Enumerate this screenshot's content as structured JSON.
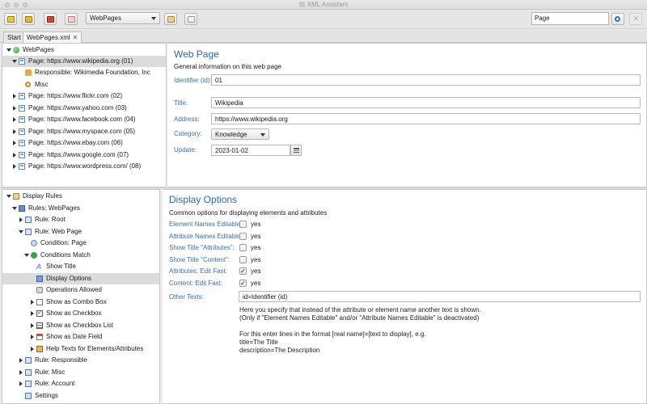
{
  "window": {
    "title": "XML Assistant"
  },
  "toolbar": {
    "collection": "WebPages",
    "search_value": "Page"
  },
  "tabs": [
    {
      "label": "Start"
    },
    {
      "label": "WebPages.xml"
    }
  ],
  "tree_top": {
    "root": "WebPages",
    "selected": "Page: https://www.wikipedia.org (01)",
    "child_responsible": "Responsible: Wikimedia Foundation, Inc",
    "child_misc": "Misc",
    "pages": [
      "Page: https://www.flickr.com (02)",
      "Page: https://www.yahoo.com (03)",
      "Page: https://www.facebook.com (04)",
      "Page: https://www.myspace.com (05)",
      "Page: https://www.ebay.com (06)",
      "Page: https://www.google.com (07)",
      "Page: https://www.wordpress.com/ (08)"
    ]
  },
  "webpage": {
    "heading": "Web Page",
    "subheading": "General information on this web page",
    "identifier_label": "Identifier (id):",
    "identifier_value": "01",
    "title_label": "Title:",
    "title_value": "Wikipedia",
    "address_label": "Address:",
    "address_value": "https://www.wikipedia.org",
    "category_label": "Category:",
    "category_value": "Knowledge",
    "update_label": "Update:",
    "update_value": "2023-01-02"
  },
  "tree_bottom": {
    "display_rules": "Display Rules",
    "rules_webpages": "Rules: WebPages",
    "rule_root": "Rule: Root",
    "rule_webpage": "Rule: Web Page",
    "condition_page": "Condition: Page",
    "conditions_match": "Conditions Match",
    "show_title": "Show Title",
    "display_options": "Display Options",
    "operations_allowed": "Operations Allowed",
    "show_combo": "Show as Combo Box",
    "show_checkbox": "Show as Checkbox",
    "show_checkbox_list": "Show as Checkbox List",
    "show_date": "Show as Date Field",
    "help_texts": "Help Texts for Elements/Attributes",
    "rule_responsible": "Rule: Responsible",
    "rule_misc": "Rule: Misc",
    "rule_account": "Rule: Account",
    "settings": "Settings"
  },
  "display_options": {
    "heading": "Display Options",
    "subheading": "Common options for displaying elements and attributes",
    "options": [
      {
        "label": "Element Names Editable:",
        "checked": false,
        "text": "yes"
      },
      {
        "label": "Attribute Names Editable:",
        "checked": false,
        "text": "yes"
      },
      {
        "label": "Show Title \"Attributes\":",
        "checked": false,
        "text": "yes"
      },
      {
        "label": "Show Title \"Content\":",
        "checked": false,
        "text": "yes"
      },
      {
        "label": "Attributes: Edit Fast:",
        "checked": true,
        "text": "yes"
      },
      {
        "label": "Content: Edit Fast:",
        "checked": true,
        "text": "yes"
      }
    ],
    "other_texts_label": "Other Texts:",
    "other_texts_value": "id=Identifier (id)",
    "help_lines": [
      "Here you specify that instead of the attribute or element name another text is shown.",
      "(Only if \"Element Names Editable\" and/or \"Attribute Names Editable\" is deactivated)",
      "",
      "For this enter lines in the format [real name]=[text to display], e.g.",
      "title=The Title",
      "description=The Description"
    ]
  },
  "colors": {
    "accent": "#2d6aa8",
    "selection": "#dcdcdc"
  }
}
